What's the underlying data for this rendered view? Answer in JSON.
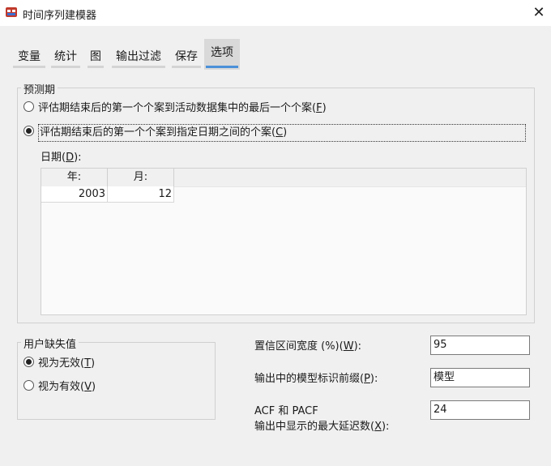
{
  "window": {
    "title": "时间序列建模器",
    "close_symbol": "✕"
  },
  "tabs": [
    {
      "label": "变量"
    },
    {
      "label": "统计"
    },
    {
      "label": "图"
    },
    {
      "label": "输出过滤"
    },
    {
      "label": "保存"
    },
    {
      "label": "选项"
    }
  ],
  "forecast_period": {
    "legend": "预测期",
    "option1_text": "评估期结束后的第一个个案到活动数据集中的最后一个个案(",
    "option1_key": "F",
    "option1_end": ")",
    "option2_text": "评估期结束后的第一个个案到指定日期之间的个案(",
    "option2_key": "C",
    "option2_end": ")",
    "date_label_text": "日期(",
    "date_label_key": "D",
    "date_label_end": "):",
    "date_columns": [
      {
        "header": "年:",
        "value": "2003"
      },
      {
        "header": "月:",
        "value": "12"
      }
    ]
  },
  "user_missing": {
    "legend": "用户缺失值",
    "option1_text": "视为无效(",
    "option1_key": "T",
    "option1_end": ")",
    "option2_text": "视为有效(",
    "option2_key": "V",
    "option2_end": ")"
  },
  "settings": {
    "ci_label_text": "置信区间宽度 (%)(",
    "ci_label_key": "W",
    "ci_label_end": "):",
    "ci_value": "95",
    "prefix_label_text": "输出中的模型标识前缀(",
    "prefix_label_key": "P",
    "prefix_label_end": "):",
    "prefix_value": "模型",
    "lag_label_line1": "ACF 和 PACF",
    "lag_label_text": "输出中显示的最大延迟数(",
    "lag_label_key": "X",
    "lag_label_end": "):",
    "lag_value": "24"
  }
}
